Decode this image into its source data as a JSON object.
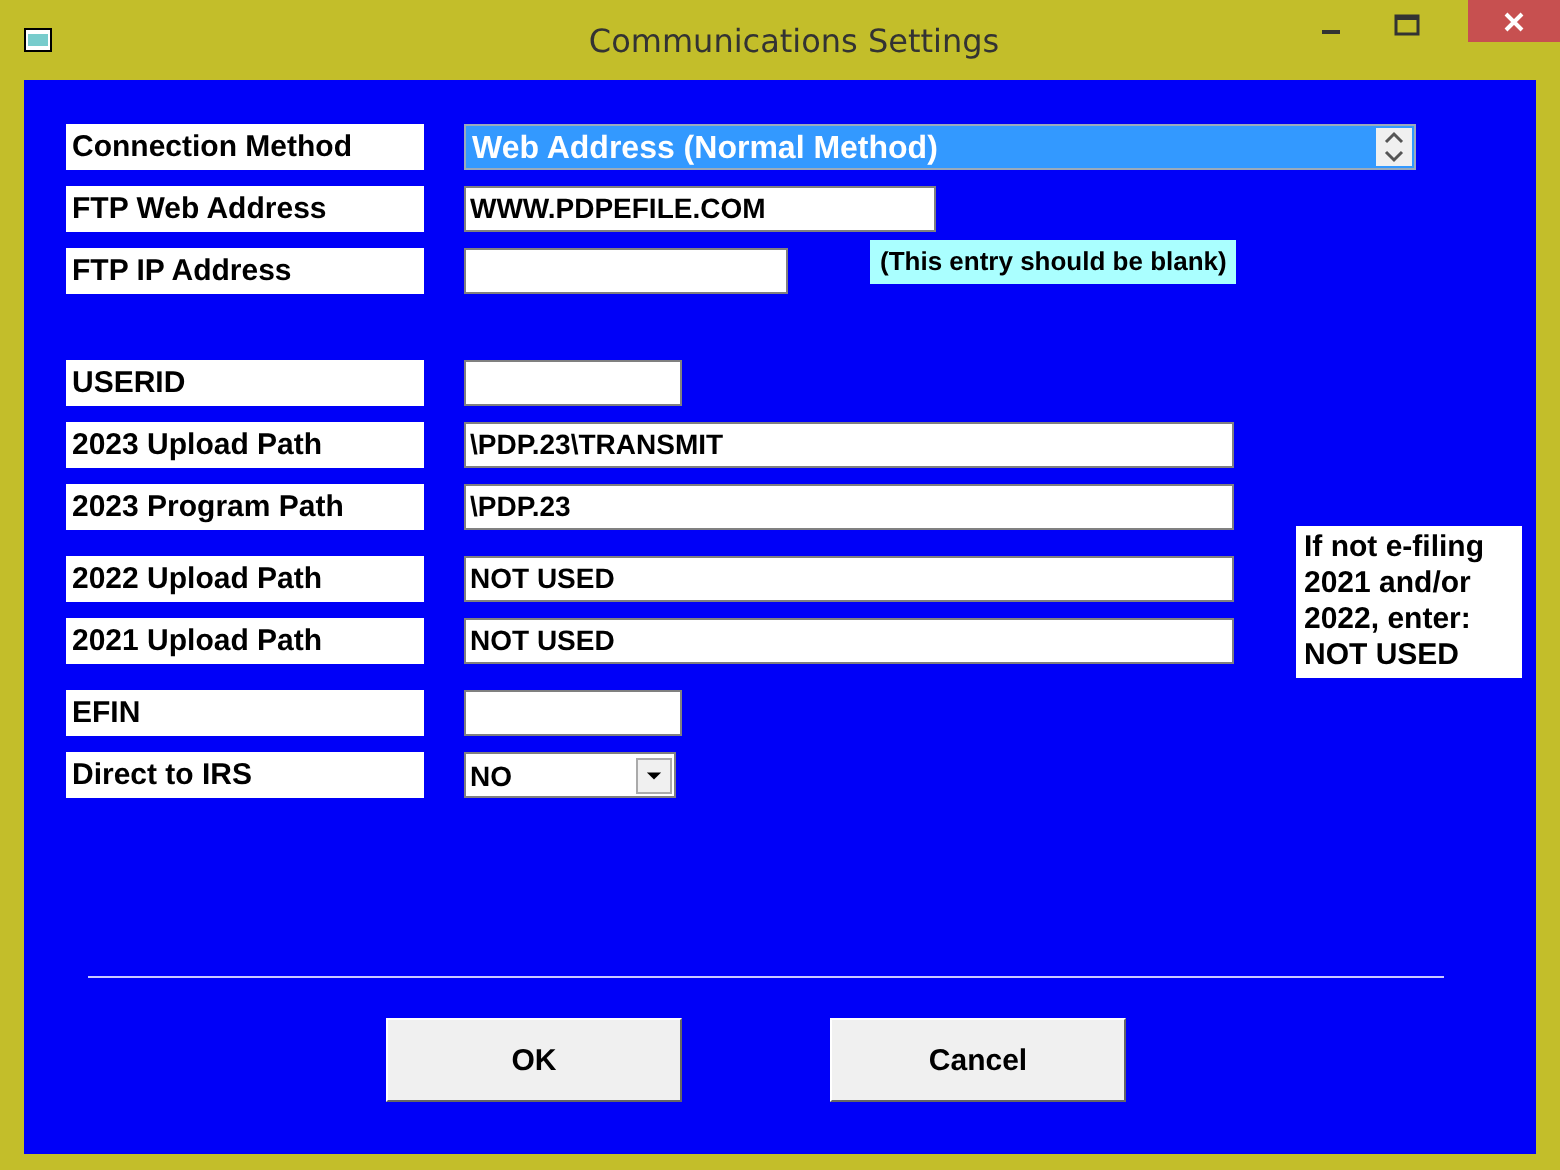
{
  "window": {
    "title": "Communications Settings"
  },
  "groups": [
    {
      "rows": [
        {
          "label": "Connection Method",
          "kind": "combo",
          "value": "Web Address (Normal Method)",
          "selected": true
        },
        {
          "label": "FTP Web Address",
          "kind": "text",
          "value": "WWW.PDPEFILE.COM"
        },
        {
          "label": "FTP IP Address",
          "kind": "text",
          "note": "(This entry should be blank)"
        }
      ]
    },
    {
      "rows": [
        {
          "label": "USERID",
          "kind": "text"
        },
        {
          "label": "2023 Upload Path",
          "kind": "text",
          "value": "\\PDP.23\\TRANSMIT"
        },
        {
          "label": "2023 Program Path",
          "kind": "text",
          "value": "\\PDP.23"
        }
      ]
    },
    {
      "rows": [
        {
          "label": "2022 Upload Path",
          "kind": "text",
          "value": "NOT USED"
        },
        {
          "label": "2021 Upload Path",
          "kind": "text",
          "value": "NOT USED"
        }
      ],
      "side_note": "If not e-filing 2021 and/or 2022, enter: NOT USED"
    },
    {
      "rows": [
        {
          "label": "EFIN",
          "kind": "text"
        },
        {
          "label": "Direct to IRS",
          "kind": "dropdown",
          "value": "NO"
        }
      ]
    }
  ],
  "buttons": [
    "OK",
    "Cancel"
  ]
}
